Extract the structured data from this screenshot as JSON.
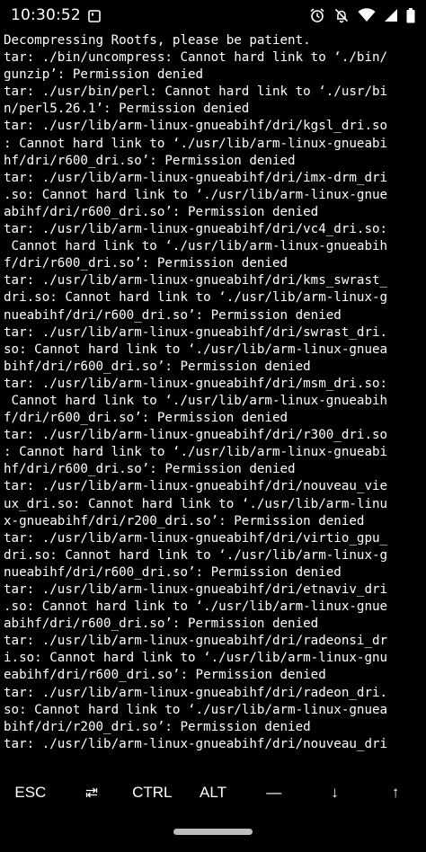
{
  "status_bar": {
    "time": "10:30:52",
    "left_icons": [
      "screenshot-notification-icon"
    ],
    "right_icons": [
      "alarm-icon",
      "notifications-off-icon",
      "wifi-icon",
      "signal-icon",
      "battery-icon"
    ]
  },
  "terminal": {
    "lines": [
      "Decompressing Rootfs, please be patient.",
      "tar: ./bin/uncompress: Cannot hard link to ‘./bin/",
      "gunzip’: Permission denied",
      "tar: ./usr/bin/perl: Cannot hard link to ‘./usr/bi",
      "n/perl5.26.1’: Permission denied",
      "tar: ./usr/lib/arm-linux-gnueabihf/dri/kgsl_dri.so",
      ": Cannot hard link to ‘./usr/lib/arm-linux-gnueabi",
      "hf/dri/r600_dri.so’: Permission denied",
      "tar: ./usr/lib/arm-linux-gnueabihf/dri/imx-drm_dri",
      ".so: Cannot hard link to ‘./usr/lib/arm-linux-gnue",
      "abihf/dri/r600_dri.so’: Permission denied",
      "tar: ./usr/lib/arm-linux-gnueabihf/dri/vc4_dri.so:",
      " Cannot hard link to ‘./usr/lib/arm-linux-gnueabih",
      "f/dri/r600_dri.so’: Permission denied",
      "tar: ./usr/lib/arm-linux-gnueabihf/dri/kms_swrast_",
      "dri.so: Cannot hard link to ‘./usr/lib/arm-linux-g",
      "nueabihf/dri/r600_dri.so’: Permission denied",
      "tar: ./usr/lib/arm-linux-gnueabihf/dri/swrast_dri.",
      "so: Cannot hard link to ‘./usr/lib/arm-linux-gnuea",
      "bihf/dri/r600_dri.so’: Permission denied",
      "tar: ./usr/lib/arm-linux-gnueabihf/dri/msm_dri.so:",
      " Cannot hard link to ‘./usr/lib/arm-linux-gnueabih",
      "f/dri/r600_dri.so’: Permission denied",
      "tar: ./usr/lib/arm-linux-gnueabihf/dri/r300_dri.so",
      ": Cannot hard link to ‘./usr/lib/arm-linux-gnueabi",
      "hf/dri/r600_dri.so’: Permission denied",
      "tar: ./usr/lib/arm-linux-gnueabihf/dri/nouveau_vie",
      "ux_dri.so: Cannot hard link to ‘./usr/lib/arm-linu",
      "x-gnueabihf/dri/r200_dri.so’: Permission denied",
      "tar: ./usr/lib/arm-linux-gnueabihf/dri/virtio_gpu_",
      "dri.so: Cannot hard link to ‘./usr/lib/arm-linux-g",
      "nueabihf/dri/r600_dri.so’: Permission denied",
      "tar: ./usr/lib/arm-linux-gnueabihf/dri/etnaviv_dri",
      ".so: Cannot hard link to ‘./usr/lib/arm-linux-gnue",
      "abihf/dri/r600_dri.so’: Permission denied",
      "tar: ./usr/lib/arm-linux-gnueabihf/dri/radeonsi_dr",
      "i.so: Cannot hard link to ‘./usr/lib/arm-linux-gnu",
      "eabihf/dri/r600_dri.so’: Permission denied",
      "tar: ./usr/lib/arm-linux-gnueabihf/dri/radeon_dri.",
      "so: Cannot hard link to ‘./usr/lib/arm-linux-gnuea",
      "bihf/dri/r200_dri.so’: Permission denied",
      "tar: ./usr/lib/arm-linux-gnueabihf/dri/nouveau_dri"
    ]
  },
  "extra_keys": [
    {
      "label": "ESC",
      "name": "esc-key"
    },
    {
      "label": "",
      "name": "tab-key",
      "icon": "tab-arrows-icon"
    },
    {
      "label": "CTRL",
      "name": "ctrl-key"
    },
    {
      "label": "ALT",
      "name": "alt-key"
    },
    {
      "label": "—",
      "name": "dash-key"
    },
    {
      "label": "↓",
      "name": "arrow-down-key"
    },
    {
      "label": "↑",
      "name": "arrow-up-key"
    }
  ],
  "colors": {
    "background": "#000000",
    "foreground": "#ffffff",
    "gesture_bar": "#bdbdbd"
  }
}
